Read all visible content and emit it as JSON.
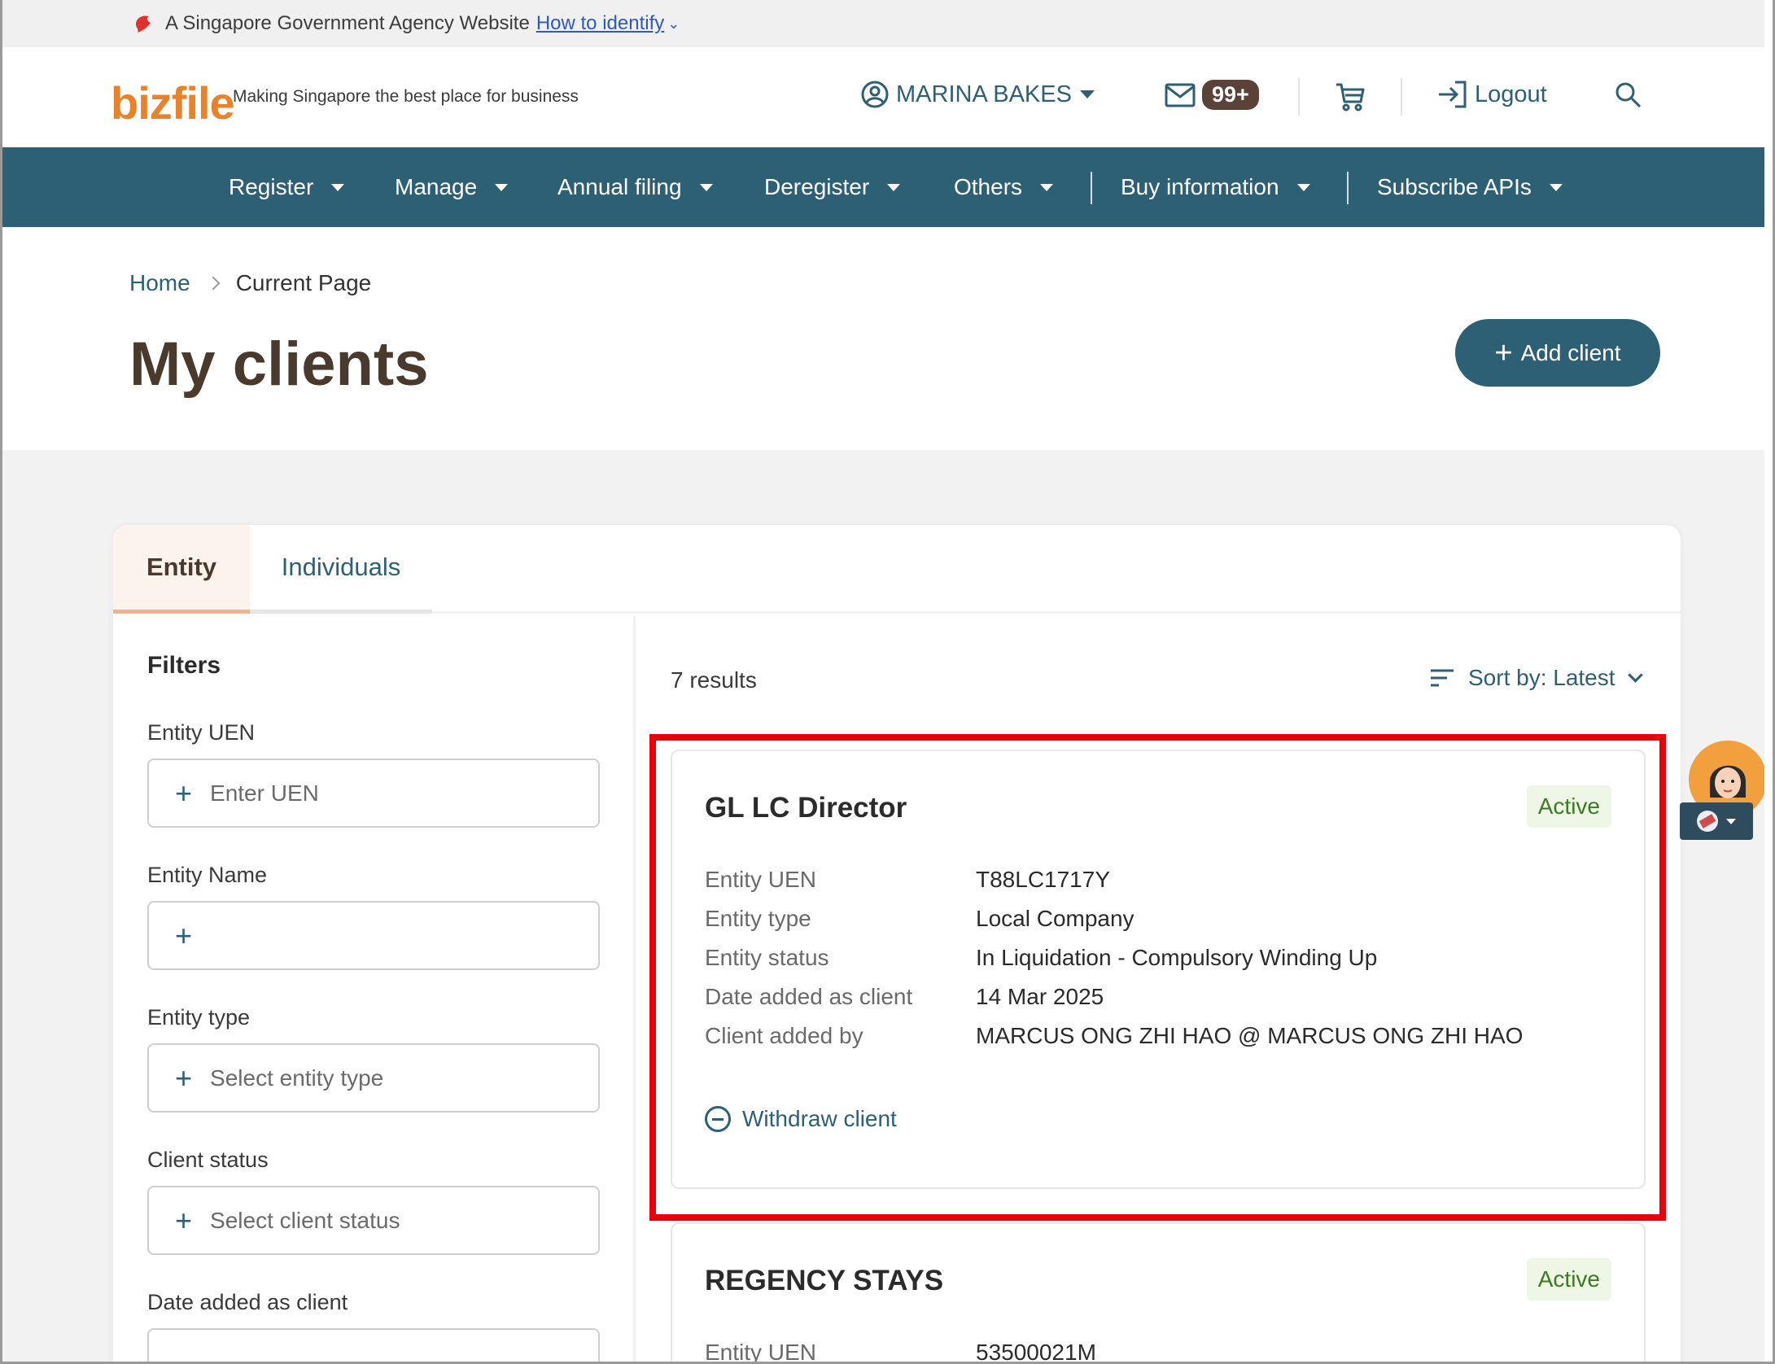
{
  "masthead": {
    "text": "A Singapore Government Agency Website",
    "link": "How to identify"
  },
  "header": {
    "logo": "bizfile",
    "tagline": "Making Singapore the best place for business",
    "user": "MARINA BAKES",
    "mail_badge": "99+",
    "logout": "Logout"
  },
  "nav": [
    "Register",
    "Manage",
    "Annual filing",
    "Deregister",
    "Others",
    "Buy information",
    "Subscribe APIs"
  ],
  "breadcrumb": {
    "home": "Home",
    "current": "Current Page"
  },
  "page_title": "My clients",
  "add_client": "Add client",
  "tabs": {
    "entity": "Entity",
    "individuals": "Individuals"
  },
  "filters": {
    "title": "Filters",
    "uen_label": "Entity UEN",
    "uen_placeholder": "Enter UEN",
    "name_label": "Entity Name",
    "type_label": "Entity type",
    "type_placeholder": "Select entity type",
    "status_label": "Client status",
    "status_placeholder": "Select client status",
    "date_label": "Date added as client"
  },
  "results": "7 results",
  "sort": "Sort by: Latest",
  "clients": [
    {
      "name": "GL LC Director",
      "status": "Active",
      "fields": [
        {
          "k": "Entity UEN",
          "v": "T88LC1717Y"
        },
        {
          "k": "Entity type",
          "v": "Local Company"
        },
        {
          "k": "Entity status",
          "v": "In Liquidation - Compulsory Winding Up"
        },
        {
          "k": "Date added as client",
          "v": "14 Mar 2025"
        },
        {
          "k": "Client added by",
          "v": "MARCUS ONG ZHI HAO @ MARCUS ONG ZHI HAO"
        }
      ],
      "action": "Withdraw client"
    },
    {
      "name": "REGENCY STAYS",
      "status": "Active",
      "fields": [
        {
          "k": "Entity UEN",
          "v": "53500021M"
        }
      ]
    }
  ],
  "colors": {
    "brand": "#2e6075",
    "accent": "#e8822b",
    "highlight": "#e8000b",
    "active": "#3d7a25"
  }
}
